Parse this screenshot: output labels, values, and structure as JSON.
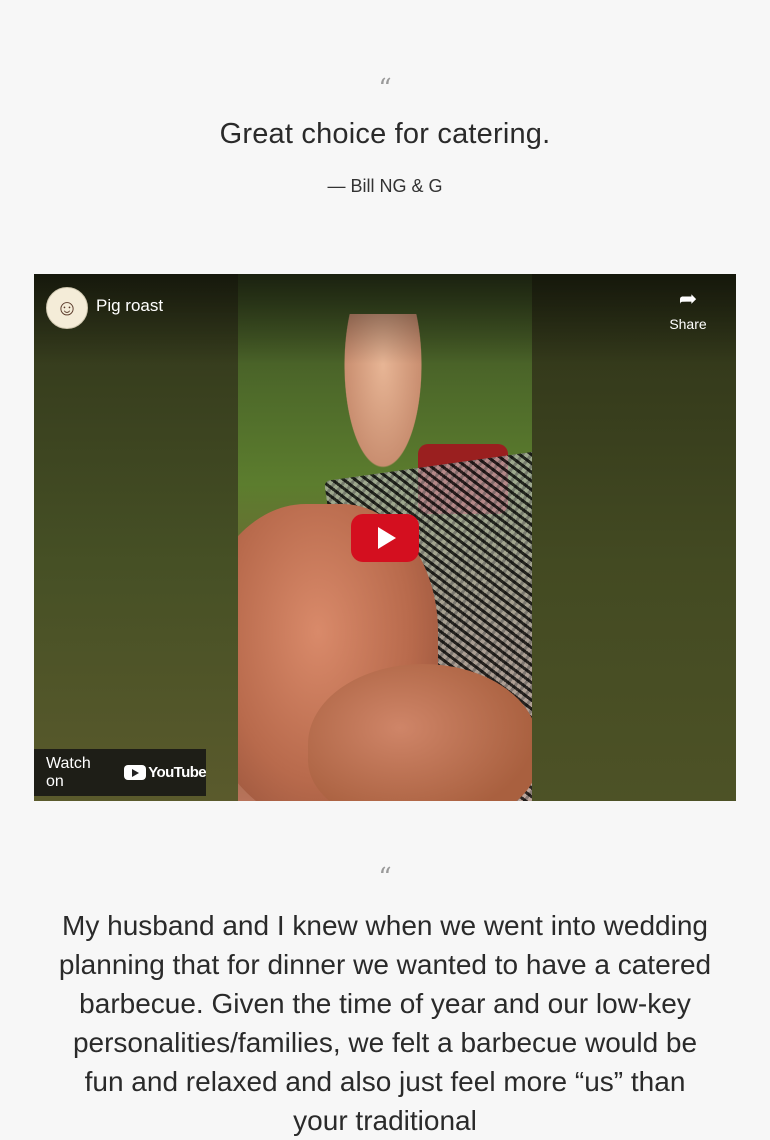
{
  "testimonial_1": {
    "quote_mark": "“",
    "text": "Great choice for catering.",
    "author": "— Bill NG & G"
  },
  "video": {
    "title": "Pig roast",
    "share_label": "Share",
    "watch_on_label": "Watch on",
    "youtube_label": "YouTube"
  },
  "testimonial_2": {
    "quote_mark": "“",
    "text": "My husband and I knew when we went into wedding planning that for dinner we wanted to have a catered barbecue. Given the time of year and our low-key personalities/families, we felt a barbecue would be fun and relaxed and also just feel more “us” than your traditional"
  },
  "colors": {
    "background": "#f7f7f7",
    "play_button": "#d40f1f",
    "text": "#2a2a2a"
  }
}
